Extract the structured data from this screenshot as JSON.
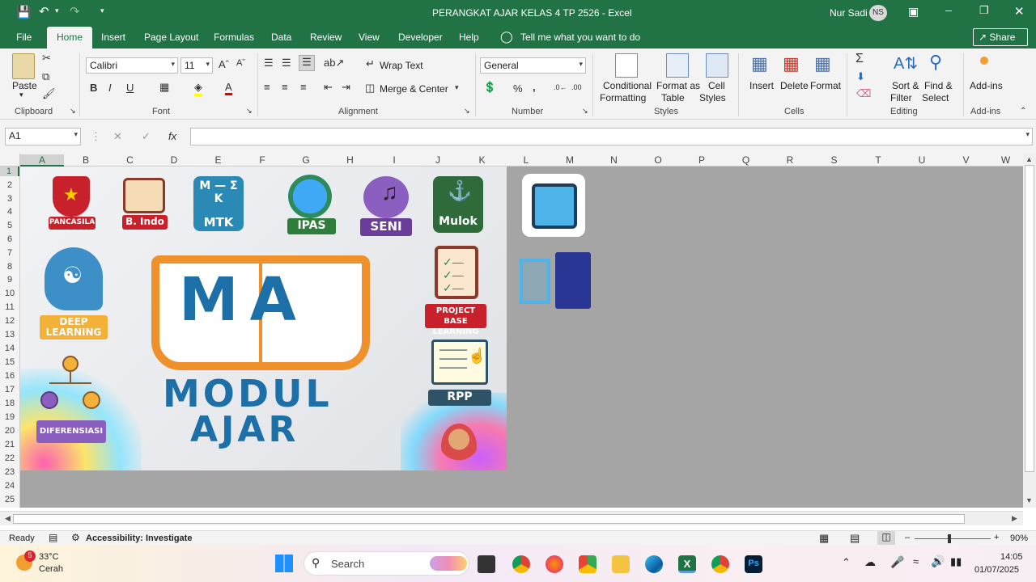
{
  "window": {
    "title": "PERANGKAT AJAR KELAS 4 TP 2526  -  Excel",
    "user": "Nur Sadi",
    "user_initials": "NS"
  },
  "tabs": [
    "File",
    "Home",
    "Insert",
    "Page Layout",
    "Formulas",
    "Data",
    "Review",
    "View",
    "Developer",
    "Help"
  ],
  "tell_me": "Tell me what you want to do",
  "share": "Share",
  "ribbon": {
    "clipboard": {
      "paste": "Paste",
      "label": "Clipboard"
    },
    "font": {
      "name": "Calibri",
      "size": "11",
      "label": "Font"
    },
    "alignment": {
      "wrap": "Wrap Text",
      "merge": "Merge & Center",
      "label": "Alignment"
    },
    "number": {
      "format": "General",
      "label": "Number"
    },
    "styles": {
      "cond1": "Conditional",
      "cond2": "Formatting",
      "fmt1": "Format as",
      "fmt2": "Table",
      "cell1": "Cell",
      "cell2": "Styles",
      "label": "Styles"
    },
    "cells": {
      "insert": "Insert",
      "delete": "Delete",
      "format": "Format",
      "label": "Cells"
    },
    "editing": {
      "sort1": "Sort &",
      "sort2": "Filter",
      "find1": "Find &",
      "find2": "Select",
      "label": "Editing"
    },
    "addins": {
      "btn": "Add-ins",
      "label": "Add-ins"
    }
  },
  "formula_bar": {
    "name_box": "A1",
    "fx": "fx",
    "value": ""
  },
  "columns": [
    "A",
    "B",
    "C",
    "D",
    "E",
    "F",
    "G",
    "H",
    "I",
    "J",
    "K",
    "L",
    "M",
    "N",
    "O",
    "P",
    "Q",
    "R",
    "S",
    "T",
    "U",
    "V",
    "W"
  ],
  "rows": [
    "1",
    "2",
    "3",
    "4",
    "5",
    "6",
    "7",
    "8",
    "9",
    "10",
    "11",
    "12",
    "13",
    "14",
    "15",
    "16",
    "17",
    "18",
    "19",
    "20",
    "21",
    "22",
    "23",
    "24",
    "25"
  ],
  "poster": {
    "subjects": [
      "PANCASILA",
      "B. Indo",
      "MTK",
      "IPAS",
      "SENI",
      "Mulok"
    ],
    "mtk_symbol": "M — Σ K",
    "deep": "DEEP LEARNING",
    "project": "PROJECT BASE LEARNING",
    "rpp": "RPP",
    "diferensiasi": "DIFERENSIASI",
    "ma": "MA",
    "modul": "MODUL",
    "ajar": "AJAR"
  },
  "status": {
    "ready": "Ready",
    "accessibility": "Accessibility: Investigate",
    "zoom": "90%"
  },
  "taskbar": {
    "temp": "33°C",
    "weather": "Cerah",
    "badge": "5",
    "search": "Search",
    "time": "14:05",
    "date": "01/07/2025"
  },
  "colors": {
    "excel_green": "#217346",
    "grid_gray": "#a5a5a5",
    "poster_orange": "#f0902a",
    "poster_blue": "#1d6fa8"
  }
}
